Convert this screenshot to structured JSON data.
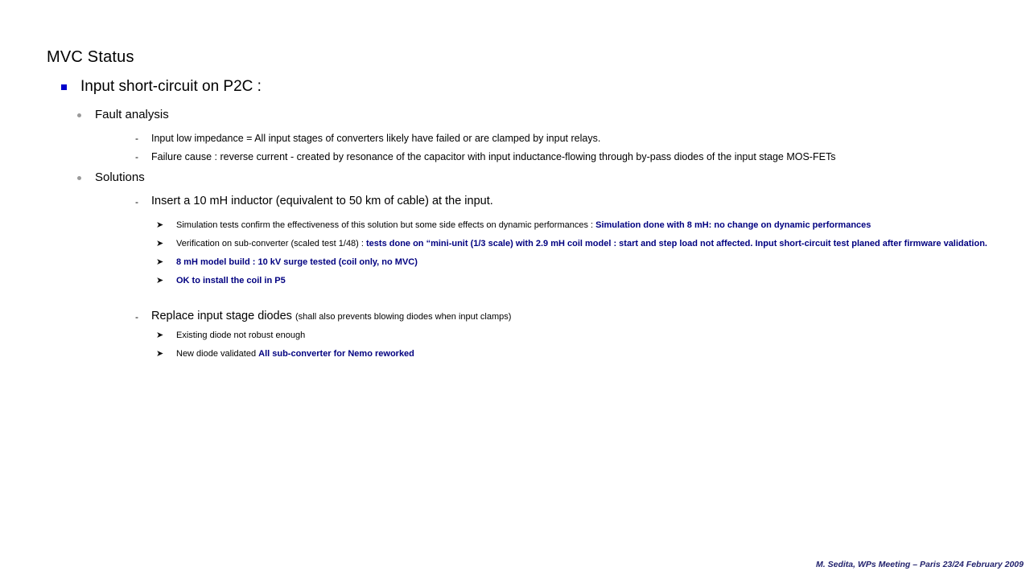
{
  "slide": {
    "title": "MVC Status",
    "level1": {
      "text": "Input short-circuit on P2C :",
      "bullet_icon": "square-bullet-icon",
      "bullet_color": "#0000CC"
    },
    "sections": [
      {
        "heading": "Fault analysis",
        "bullet_icon": "dot-bullet-icon",
        "items": [
          {
            "bullet_icon": "dash-bullet-icon",
            "text": "Input low impedance = All input stages of converters likely have failed or are clamped by input relays."
          },
          {
            "bullet_icon": "dash-bullet-icon",
            "text": "Failure cause : reverse current - created by resonance of the capacitor with input inductance-flowing through by-pass diodes of the input stage MOS-FETs"
          }
        ]
      },
      {
        "heading": "Solutions",
        "bullet_icon": "dot-bullet-icon",
        "items": [
          {
            "bullet_icon": "dash-bullet-icon",
            "text": "Insert a 10 mH  inductor (equivalent to 50 km of cable) at the input.",
            "note": "",
            "subitems": [
              {
                "bullet_icon": "arrow-bullet-icon",
                "plain": " Simulation tests confirm the effectiveness of this solution but some side effects on dynamic performances : ",
                "blue": "Simulation done with 8 mH: no change on dynamic performances"
              },
              {
                "bullet_icon": "arrow-bullet-icon",
                "plain": "Verification on sub-converter (scaled test 1/48) : ",
                "blue": "tests done on “mini-unit (1/3 scale) with 2.9 mH coil model : start and step load not affected. Input short-circuit test planed after firmware validation."
              },
              {
                "bullet_icon": "arrow-bullet-icon",
                "plain": "",
                "blue": "8 mH model build : 10 kV surge tested (coil only, no MVC)"
              },
              {
                "bullet_icon": "arrow-bullet-icon",
                "plain": "",
                "blue": "OK to install the coil in P5"
              }
            ]
          },
          {
            "bullet_icon": "dash-bullet-icon",
            "text": "Replace input stage diodes ",
            "note": "(shall also prevents blowing diodes when input clamps)",
            "subitems": [
              {
                "bullet_icon": "arrow-bullet-icon",
                "plain": "Existing diode not robust enough",
                "blue": ""
              },
              {
                "bullet_icon": "arrow-bullet-icon",
                "plain": "New diode validated ",
                "blue": "All sub-converter for Nemo reworked"
              }
            ]
          }
        ]
      }
    ],
    "footer": "M. Sedita, WPs Meeting – Paris 23/24 February 2009",
    "colors": {
      "accent_blue": "#000080",
      "bullet_blue": "#0000CC",
      "bullet_gray": "#9a9a9a",
      "footer_blue": "#1f1f6b"
    }
  }
}
